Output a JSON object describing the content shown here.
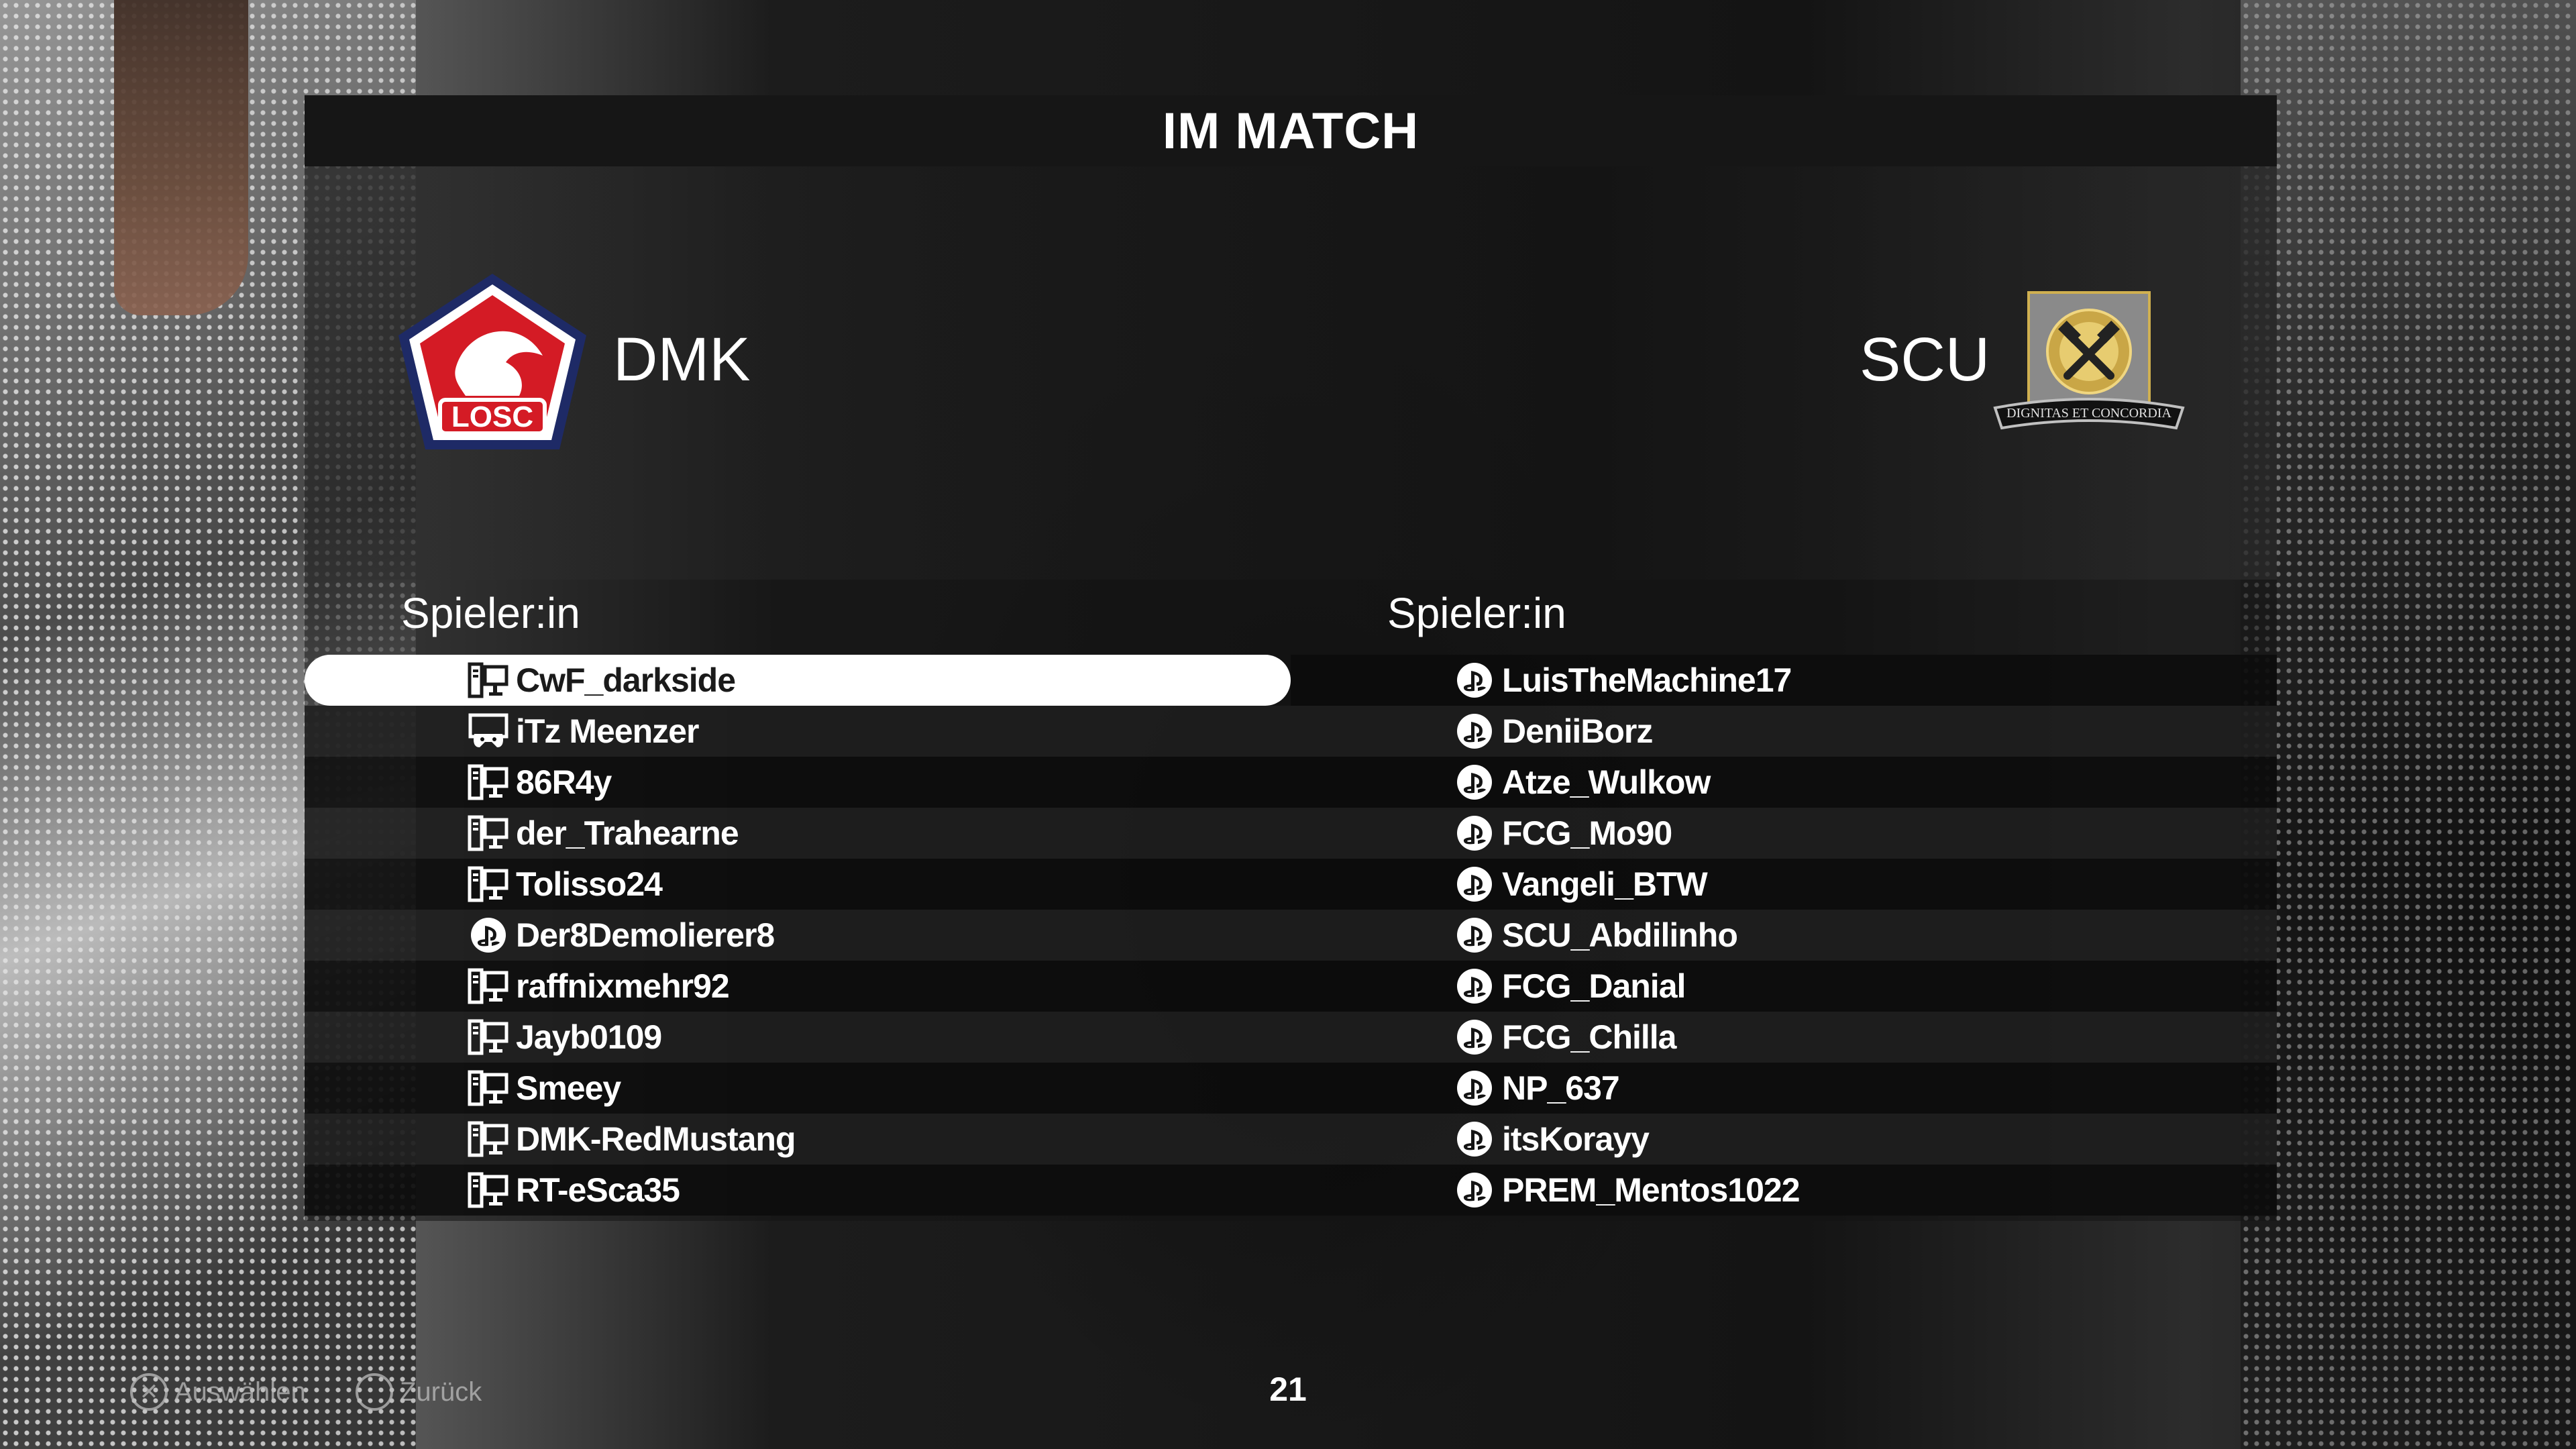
{
  "screen_title": "IM MATCH",
  "home_team": {
    "name": "DMK",
    "logo_text": "LOSC",
    "icon": "losc-crest-icon"
  },
  "away_team": {
    "name": "SCU",
    "logo_text": "DIGNITAS ET CONCORDIA",
    "icon": "hammer-crest-icon"
  },
  "columns": {
    "home_header": "Spieler:in",
    "away_header": "Spieler:in"
  },
  "home_players": [
    {
      "name": "CwF_darkside",
      "platform": "pc-icon",
      "selected": true
    },
    {
      "name": "iTz Meenzer",
      "platform": "pc-controller-icon"
    },
    {
      "name": "86R4y",
      "platform": "pc-icon"
    },
    {
      "name": "der_Trahearne",
      "platform": "pc-icon"
    },
    {
      "name": "Tolisso24",
      "platform": "pc-icon"
    },
    {
      "name": "Der8Demolierer8",
      "platform": "playstation-icon"
    },
    {
      "name": "raffnixmehr92",
      "platform": "pc-icon"
    },
    {
      "name": "Jayb0109",
      "platform": "pc-icon"
    },
    {
      "name": "Smeey",
      "platform": "pc-icon"
    },
    {
      "name": "DMK-RedMustang",
      "platform": "pc-icon"
    },
    {
      "name": "RT-eSca35",
      "platform": "pc-icon"
    }
  ],
  "away_players": [
    {
      "name": "LuisTheMachine17",
      "platform": "playstation-icon"
    },
    {
      "name": "DeniiBorz",
      "platform": "playstation-icon"
    },
    {
      "name": "Atze_Wulkow",
      "platform": "playstation-icon"
    },
    {
      "name": "FCG_Mo90",
      "platform": "playstation-icon"
    },
    {
      "name": "Vangeli_BTW",
      "platform": "playstation-icon"
    },
    {
      "name": "SCU_Abdilinho",
      "platform": "playstation-icon"
    },
    {
      "name": "FCG_Danial",
      "platform": "playstation-icon"
    },
    {
      "name": "FCG_Chilla",
      "platform": "playstation-icon"
    },
    {
      "name": "NP_637",
      "platform": "playstation-icon"
    },
    {
      "name": "itsKorayy",
      "platform": "playstation-icon"
    },
    {
      "name": "PREM_Mentos1022",
      "platform": "playstation-icon"
    }
  ],
  "footer": {
    "select_label": "Auswählen",
    "back_label": "Zurück",
    "page_number": "21"
  }
}
